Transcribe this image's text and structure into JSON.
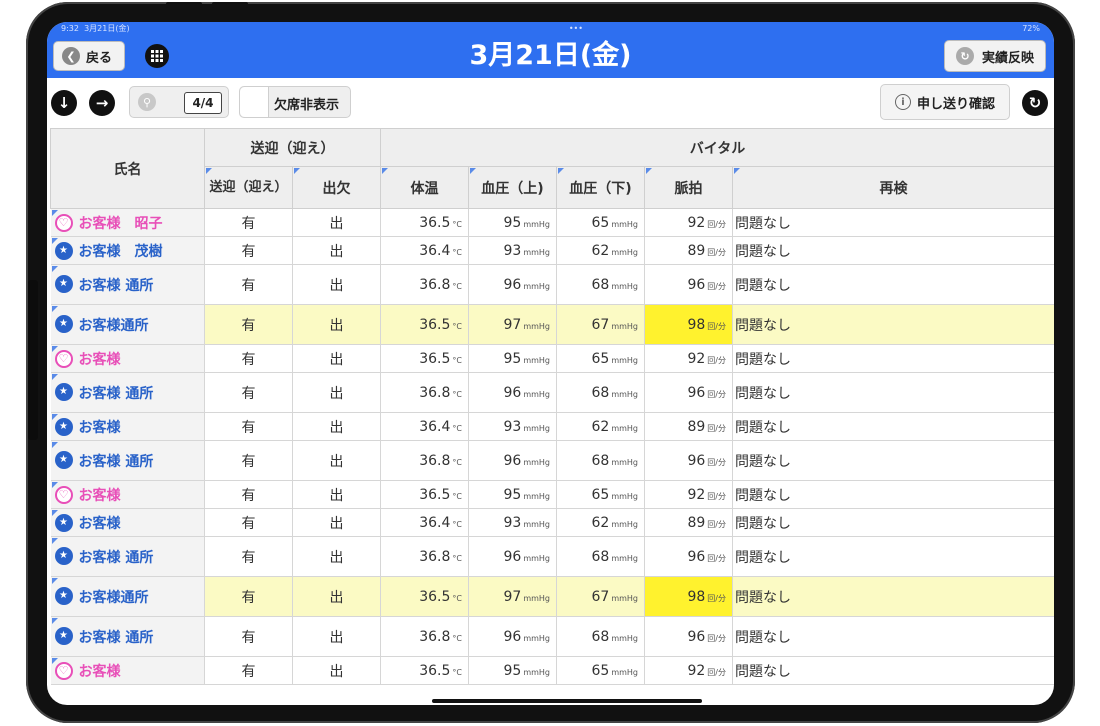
{
  "status": {
    "time": "9:32",
    "date": "3月21日(金)",
    "battery": "72%",
    "dots": "•••"
  },
  "header": {
    "title": "3月21日(金)",
    "back_label": "戻る",
    "apply_label": "実績反映"
  },
  "toolbar": {
    "page_indicator": "4/4",
    "absent_toggle_label": "欠席非表示",
    "handover_label": "申し送り確認"
  },
  "colors": {
    "nav_bg": "#2e6ff0",
    "female": "#e84fb8",
    "male": "#2962c9",
    "highlight_row": "#fbfac4",
    "highlight_cell": "#fff22e"
  },
  "table": {
    "group_headers": {
      "name": "氏名",
      "transport": "送迎（迎え）",
      "vital": "バイタル"
    },
    "columns": {
      "transport_pickup": "送迎（迎え）",
      "attendance": "出欠",
      "temp": "体温",
      "bp_high": "血圧（上)",
      "bp_low": "血圧（下)",
      "pulse": "脈拍",
      "recheck": "再検"
    },
    "units": {
      "temp": "°C",
      "bp": "mmHg",
      "pulse": "回/分"
    },
    "rows": [
      {
        "icon": "female",
        "name": "お客様　昭子",
        "pickup": "有",
        "attend": "出",
        "temp": "36.5",
        "bp_high": "95",
        "bp_low": "65",
        "pulse": "92",
        "recheck": "問題なし",
        "hl": false,
        "tall": false
      },
      {
        "icon": "male",
        "name": "お客様　茂樹",
        "pickup": "有",
        "attend": "出",
        "temp": "36.4",
        "bp_high": "93",
        "bp_low": "62",
        "pulse": "89",
        "recheck": "問題なし",
        "hl": false,
        "tall": false
      },
      {
        "icon": "male",
        "name": "お客様 通所",
        "pickup": "有",
        "attend": "出",
        "temp": "36.8",
        "bp_high": "96",
        "bp_low": "68",
        "pulse": "96",
        "recheck": "問題なし",
        "hl": false,
        "tall": true
      },
      {
        "icon": "male",
        "name": "お客様通所",
        "pickup": "有",
        "attend": "出",
        "temp": "36.5",
        "bp_high": "97",
        "bp_low": "67",
        "pulse": "98",
        "recheck": "問題なし",
        "hl": true,
        "tall": true
      },
      {
        "icon": "female",
        "name": "お客様",
        "pickup": "有",
        "attend": "出",
        "temp": "36.5",
        "bp_high": "95",
        "bp_low": "65",
        "pulse": "92",
        "recheck": "問題なし",
        "hl": false,
        "tall": false
      },
      {
        "icon": "male",
        "name": "お客様 通所",
        "pickup": "有",
        "attend": "出",
        "temp": "36.8",
        "bp_high": "96",
        "bp_low": "68",
        "pulse": "96",
        "recheck": "問題なし",
        "hl": false,
        "tall": true
      },
      {
        "icon": "male",
        "name": "お客様",
        "pickup": "有",
        "attend": "出",
        "temp": "36.4",
        "bp_high": "93",
        "bp_low": "62",
        "pulse": "89",
        "recheck": "問題なし",
        "hl": false,
        "tall": false
      },
      {
        "icon": "male",
        "name": "お客様 通所",
        "pickup": "有",
        "attend": "出",
        "temp": "36.8",
        "bp_high": "96",
        "bp_low": "68",
        "pulse": "96",
        "recheck": "問題なし",
        "hl": false,
        "tall": true
      },
      {
        "icon": "female",
        "name": "お客様",
        "pickup": "有",
        "attend": "出",
        "temp": "36.5",
        "bp_high": "95",
        "bp_low": "65",
        "pulse": "92",
        "recheck": "問題なし",
        "hl": false,
        "tall": false
      },
      {
        "icon": "male",
        "name": "お客様",
        "pickup": "有",
        "attend": "出",
        "temp": "36.4",
        "bp_high": "93",
        "bp_low": "62",
        "pulse": "89",
        "recheck": "問題なし",
        "hl": false,
        "tall": false
      },
      {
        "icon": "male",
        "name": "お客様 通所",
        "pickup": "有",
        "attend": "出",
        "temp": "36.8",
        "bp_high": "96",
        "bp_low": "68",
        "pulse": "96",
        "recheck": "問題なし",
        "hl": false,
        "tall": true
      },
      {
        "icon": "male",
        "name": "お客様通所",
        "pickup": "有",
        "attend": "出",
        "temp": "36.5",
        "bp_high": "97",
        "bp_low": "67",
        "pulse": "98",
        "recheck": "問題なし",
        "hl": true,
        "tall": true
      },
      {
        "icon": "male",
        "name": "お客様 通所",
        "pickup": "有",
        "attend": "出",
        "temp": "36.8",
        "bp_high": "96",
        "bp_low": "68",
        "pulse": "96",
        "recheck": "問題なし",
        "hl": false,
        "tall": true
      },
      {
        "icon": "female",
        "name": "お客様",
        "pickup": "有",
        "attend": "出",
        "temp": "36.5",
        "bp_high": "95",
        "bp_low": "65",
        "pulse": "92",
        "recheck": "問題なし",
        "hl": false,
        "tall": false
      }
    ]
  }
}
